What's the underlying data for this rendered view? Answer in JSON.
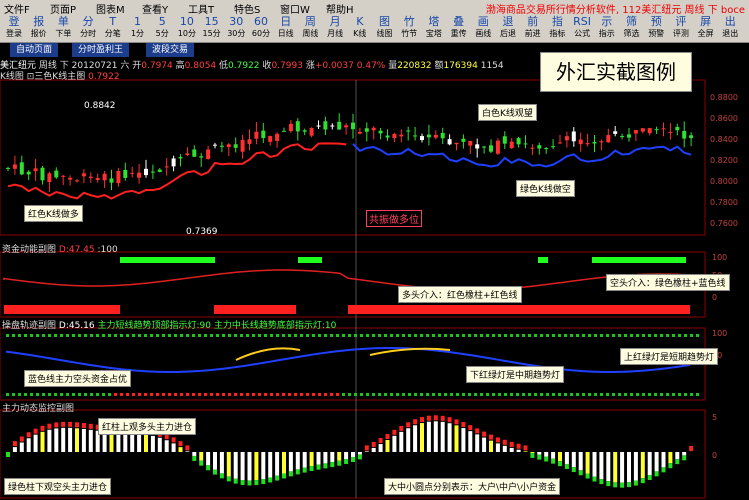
{
  "menu": [
    "文件F",
    "页面P",
    "图表M",
    "查看Y",
    "工具T",
    "特色S",
    "窗口W",
    "帮助H"
  ],
  "window_title": "渤海商品交易所行情分析软件, 112美汇纽元 周线 下 boce",
  "toolbar": [
    {
      "icon": "登",
      "label": "登录"
    },
    {
      "icon": "报",
      "label": "报价"
    },
    {
      "icon": "单",
      "label": "下单"
    },
    {
      "icon": "分",
      "label": "分时"
    },
    {
      "icon": "T",
      "label": "分笔"
    },
    {
      "icon": "1",
      "label": "1分"
    },
    {
      "icon": "5",
      "label": "5分"
    },
    {
      "icon": "10",
      "label": "10分"
    },
    {
      "icon": "15",
      "label": "15分"
    },
    {
      "icon": "30",
      "label": "30分"
    },
    {
      "icon": "60",
      "label": "60分"
    },
    {
      "icon": "日",
      "label": "日线"
    },
    {
      "icon": "周",
      "label": "周线"
    },
    {
      "icon": "月",
      "label": "月线"
    },
    {
      "icon": "K",
      "label": "K线"
    },
    {
      "icon": "图",
      "label": "线图"
    },
    {
      "icon": "竹",
      "label": "竹节"
    },
    {
      "icon": "塔",
      "label": "宝塔"
    },
    {
      "icon": "叠",
      "label": "重传"
    },
    {
      "icon": "画",
      "label": "画线"
    },
    {
      "icon": "退",
      "label": "后退"
    },
    {
      "icon": "前",
      "label": "前进"
    },
    {
      "icon": "指",
      "label": "指标"
    },
    {
      "icon": "RSI",
      "label": "公式"
    },
    {
      "icon": "示",
      "label": "指示"
    },
    {
      "icon": "筛",
      "label": "筛选"
    },
    {
      "icon": "预",
      "label": "预警"
    },
    {
      "icon": "评",
      "label": "评测"
    },
    {
      "icon": "屏",
      "label": "全屏"
    },
    {
      "icon": "出",
      "label": "退出"
    }
  ],
  "tabs": [
    "自动页面",
    "分时盈利王",
    "波段交易"
  ],
  "info": {
    "symbol": "美汇纽元",
    "period": "周线",
    "dir": "下",
    "date": "20120721",
    "weekday": "六",
    "open_label": "开",
    "open": "0.7974",
    "high_label": "高",
    "high": "0.8054",
    "low_label": "低",
    "low": "0.7922",
    "close_label": "收",
    "close": "0.7993",
    "change_label": "涨",
    "change": "+0.0037",
    "pct": "0.47%",
    "vol_label": "量",
    "vol": "220832",
    "amt_label": "额",
    "amt": "176394",
    "tail": "1154"
  },
  "main_panel": {
    "title": "K线图 ⊡三色K线主图",
    "value": "0.7922"
  },
  "big_title": "外汇实截图例",
  "annotations": {
    "high_mark": "0.8842",
    "low_mark": "0.7369",
    "red_k": "红色K线做多",
    "white_k": "白色K线观望",
    "green_k": "绿色K线做空",
    "resonance": "共振做多位",
    "multi_in": "多头介入：红色橡柱+红色线",
    "short_in": "空头介入：绿色橡柱+蓝色线",
    "blue_line": "蓝色线主力空头资金占优",
    "red_green_light": "下红绿灯是中期趋势灯",
    "up_light": "上红绿灯是短期趋势灯",
    "red_bar": "红柱上观多头主力进仓",
    "green_bar": "绿色柱下观空头主力进仓",
    "dots": "大中小圆点分别表示：大户\\中户\\小户资金"
  },
  "panel2": {
    "title": "资金动能副图",
    "d_label": "D:",
    "d_value": "47.45",
    "sep": ":",
    "v": "100"
  },
  "panel3": {
    "title": "操盘轨迹副图",
    "d_label": "D:",
    "d_value": "45.16",
    "rest": "主力短线趋势顶部指示灯:90  主力中长线趋势底部指示灯:10"
  },
  "panel4": {
    "title": "主力动态监控副图"
  },
  "price_axis": [
    "0.8800",
    "0.8600",
    "0.8400",
    "0.8200",
    "0.8000",
    "0.7800",
    "0.7600"
  ],
  "panel_axis": [
    "100",
    "50",
    "0",
    "100",
    "50",
    "5",
    "0"
  ],
  "colors": {
    "up": "#ff3030",
    "down": "#30e030",
    "white": "#ffffff",
    "ma_red": "#ff2020",
    "ma_blue": "#2040ff",
    "panel_bg": "#000000",
    "border": "#8b0000"
  }
}
